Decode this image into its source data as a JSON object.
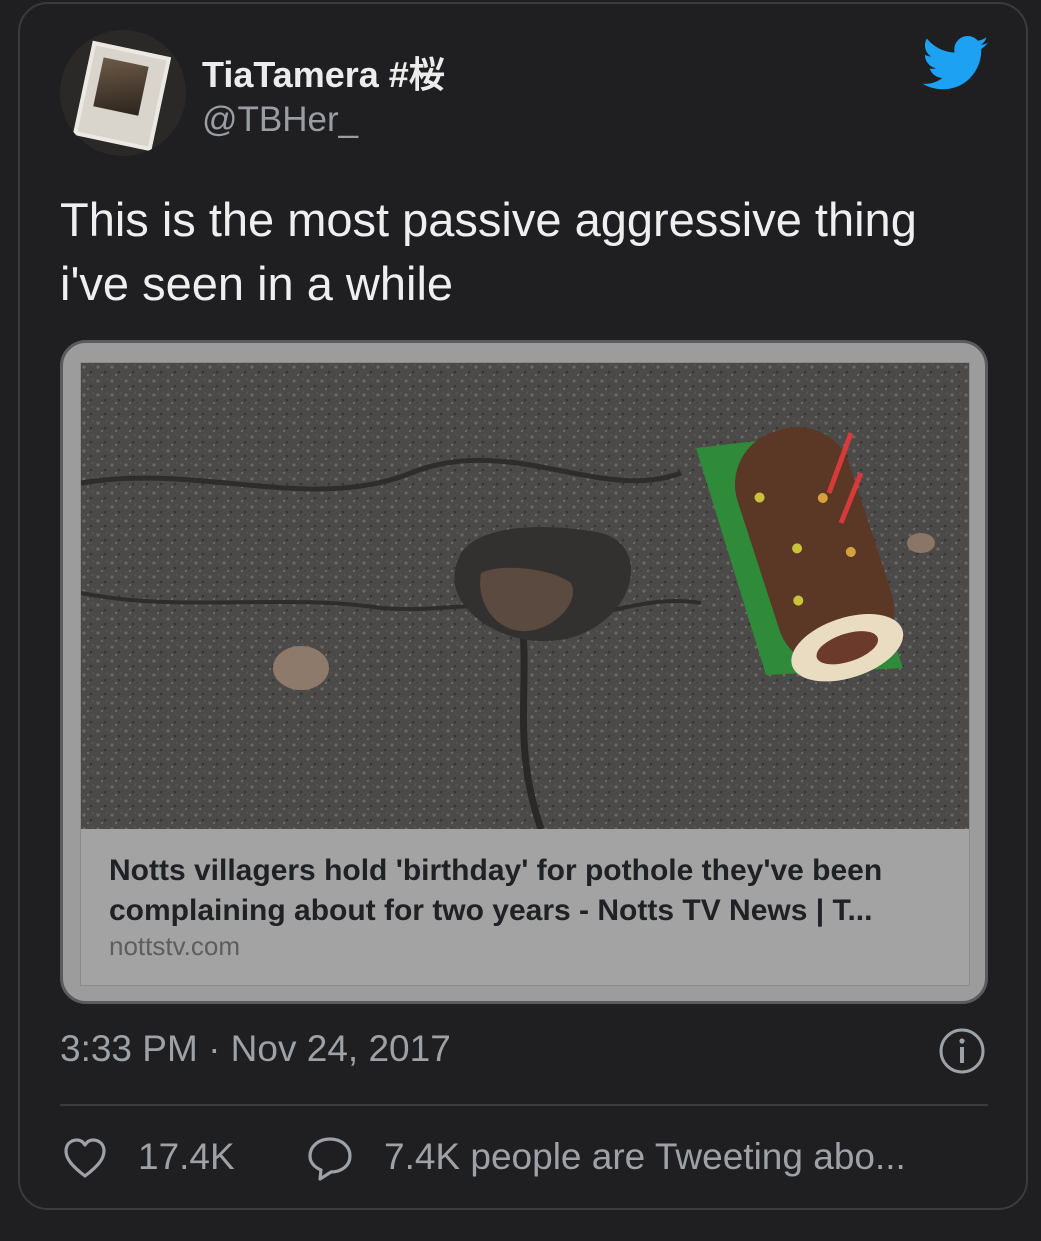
{
  "tweet": {
    "author_name": "TiaTamera #桜",
    "author_handle": "@TBHer_",
    "text_line1": "This is the most passive aggressive thing",
    "text_line2": "i've seen in a while",
    "timestamp": "3:33 PM · Nov 24, 2017"
  },
  "link_card": {
    "title_line1": "Notts villagers hold 'birthday' for pothole they've been",
    "title_line2": "complaining about for two years - Notts TV News | T...",
    "domain": "nottstv.com"
  },
  "actions": {
    "like_count": "17.4K",
    "reply_text": "7.4K people are Tweeting abo..."
  },
  "icons": {
    "brand": "twitter-bird-icon",
    "info": "info-icon",
    "like": "heart-icon",
    "reply": "speech-bubble-icon"
  },
  "colors": {
    "background": "#1f1f21",
    "twitter_blue": "#1da1f2",
    "secondary_text": "#9ea1a5"
  }
}
